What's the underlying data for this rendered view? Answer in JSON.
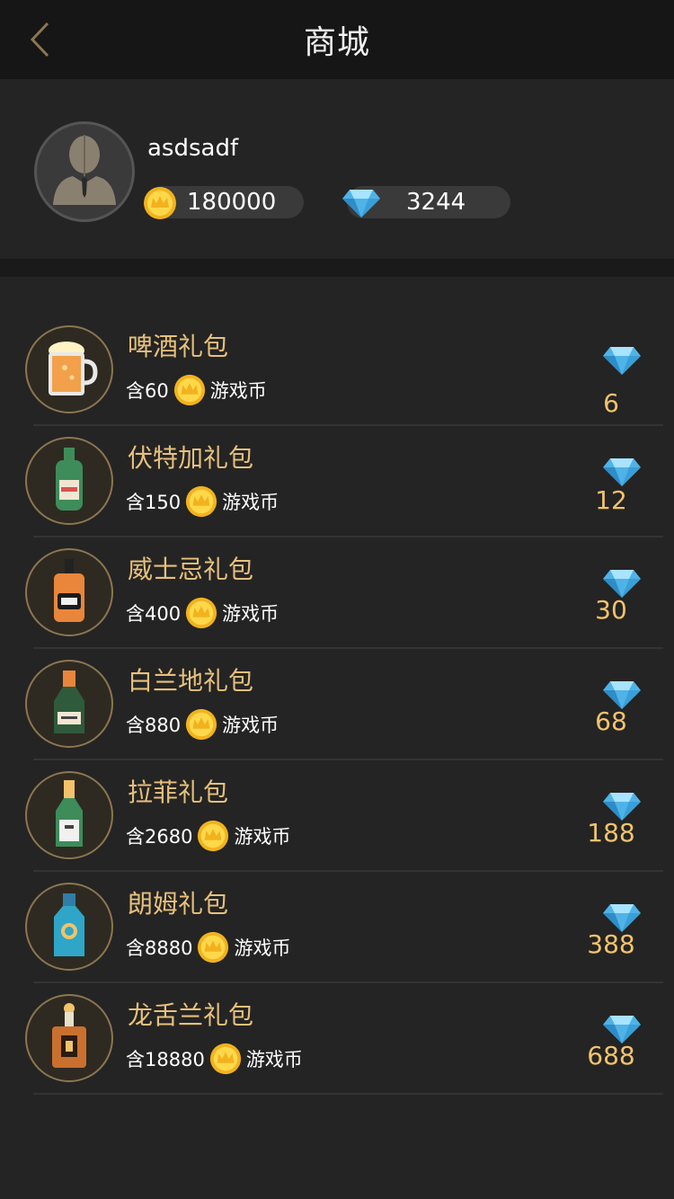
{
  "nav": {
    "title": "商城",
    "back_icon": "chevron-left-icon"
  },
  "profile": {
    "username": "asdsadf",
    "coins": "180000",
    "gems": "3244"
  },
  "colors": {
    "title_gold": "#e7c17c",
    "price_gold": "#f3c36c",
    "background": "#242424",
    "nav_bg": "#161616"
  },
  "items": [
    {
      "title": "啤酒礼包",
      "amount_prefix": "含60",
      "unit": "游戏币",
      "price": "6",
      "icon": "beer-mug-icon"
    },
    {
      "title": "伏特加礼包",
      "amount_prefix": "含150",
      "unit": "游戏币",
      "price": "12",
      "icon": "vodka-bottle-icon"
    },
    {
      "title": "威士忌礼包",
      "amount_prefix": "含400",
      "unit": "游戏币",
      "price": "30",
      "icon": "whiskey-bottle-icon"
    },
    {
      "title": "白兰地礼包",
      "amount_prefix": "含880",
      "unit": "游戏币",
      "price": "68",
      "icon": "brandy-bottle-icon"
    },
    {
      "title": "拉菲礼包",
      "amount_prefix": "含2680",
      "unit": "游戏币",
      "price": "188",
      "icon": "wine-bottle-icon"
    },
    {
      "title": "朗姆礼包",
      "amount_prefix": "含8880",
      "unit": "游戏币",
      "price": "388",
      "icon": "rum-bottle-icon"
    },
    {
      "title": "龙舌兰礼包",
      "amount_prefix": "含18880",
      "unit": "游戏币",
      "price": "688",
      "icon": "tequila-bottle-icon"
    }
  ]
}
